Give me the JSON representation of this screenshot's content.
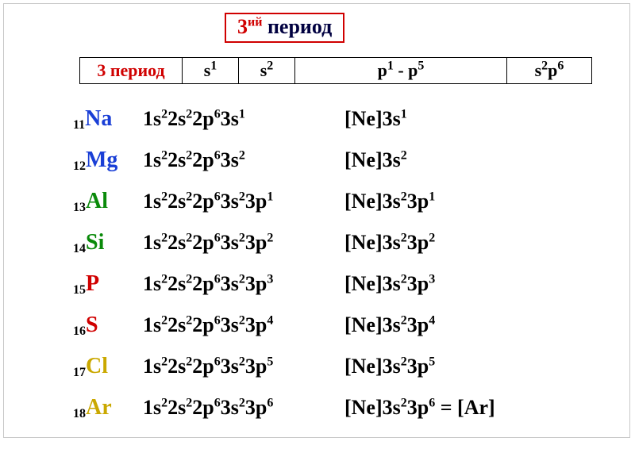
{
  "title": {
    "ordinal": "3",
    "suffix": "ий",
    "word": "период"
  },
  "header": {
    "period_label": "3 период",
    "col_s1": {
      "base": "s",
      "sup": "1"
    },
    "col_s2": {
      "base": "s",
      "sup": "2"
    },
    "col_p": {
      "left_base": "p",
      "left_sup": "1",
      "sep": " - ",
      "right_base": "p",
      "right_sup": "5"
    },
    "col_sp": {
      "a_base": "s",
      "a_sup": "2",
      "b_base": "p",
      "b_sup": "6"
    }
  },
  "noble_prefix": "[Ne]",
  "ar_suffix": " = [Ar]",
  "full_core": [
    {
      "base": "1s",
      "sup": "2"
    },
    {
      "base": "2s",
      "sup": "2"
    },
    {
      "base": "2p",
      "sup": "6"
    }
  ],
  "elements": [
    {
      "z": "11",
      "sym": "Na",
      "color": "c-blue",
      "extra": [
        {
          "base": "3s",
          "sup": "1"
        }
      ]
    },
    {
      "z": "12",
      "sym": "Mg",
      "color": "c-blue",
      "extra": [
        {
          "base": "3s",
          "sup": "2"
        }
      ]
    },
    {
      "z": "13",
      "sym": "Al",
      "color": "c-green",
      "extra": [
        {
          "base": "3s",
          "sup": "2"
        },
        {
          "base": "3p",
          "sup": "1"
        }
      ]
    },
    {
      "z": "14",
      "sym": "Si",
      "color": "c-green",
      "extra": [
        {
          "base": "3s",
          "sup": "2"
        },
        {
          "base": "3p",
          "sup": "2"
        }
      ]
    },
    {
      "z": "15",
      "sym": "P",
      "color": "c-red",
      "extra": [
        {
          "base": "3s",
          "sup": "2"
        },
        {
          "base": "3p",
          "sup": "3"
        }
      ]
    },
    {
      "z": "16",
      "sym": "S",
      "color": "c-red",
      "extra": [
        {
          "base": "3s",
          "sup": "2"
        },
        {
          "base": "3p",
          "sup": "4"
        }
      ]
    },
    {
      "z": "17",
      "sym": "Cl",
      "color": "c-yellow",
      "extra": [
        {
          "base": "3s",
          "sup": "2"
        },
        {
          "base": "3p",
          "sup": "5"
        }
      ]
    },
    {
      "z": "18",
      "sym": "Ar",
      "color": "c-yellow",
      "extra": [
        {
          "base": "3s",
          "sup": "2"
        },
        {
          "base": "3p",
          "sup": "6"
        }
      ],
      "short_suffix": true
    }
  ]
}
